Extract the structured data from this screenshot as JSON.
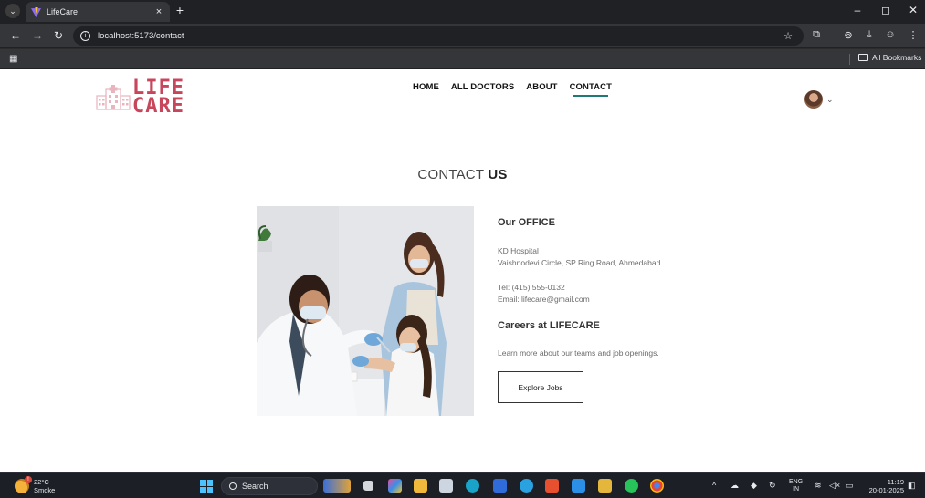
{
  "browser": {
    "tab_title": "LifeCare",
    "url": "localhost:5173/contact",
    "bookmarks_label": "All Bookmarks"
  },
  "site": {
    "logo_line1": "LIFE",
    "logo_line2": "CARE",
    "brand_color": "#c8465c",
    "nav": [
      {
        "label": "HOME",
        "active": false
      },
      {
        "label": "ALL DOCTORS",
        "active": false
      },
      {
        "label": "ABOUT",
        "active": false
      },
      {
        "label": "CONTACT",
        "active": true
      }
    ]
  },
  "contact": {
    "heading_light": "CONTACT",
    "heading_bold": "US",
    "office_title": "Our OFFICE",
    "address_line1": "KD Hospital",
    "address_line2": "Vaishnodevi Circle, SP Ring Road, Ahmedabad",
    "phone": "Tel: (415) 555-0132",
    "email": "Email: lifecare@gmail.com",
    "careers_title": "Careers at LIFECARE",
    "careers_text": "Learn more about our teams and job openings.",
    "jobs_button": "Explore Jobs"
  },
  "taskbar": {
    "temperature": "22°C",
    "weather": "Smoke",
    "search_placeholder": "Search",
    "lang_line1": "ENG",
    "lang_line2": "IN",
    "time": "11:19",
    "date": "20-01-2025"
  }
}
